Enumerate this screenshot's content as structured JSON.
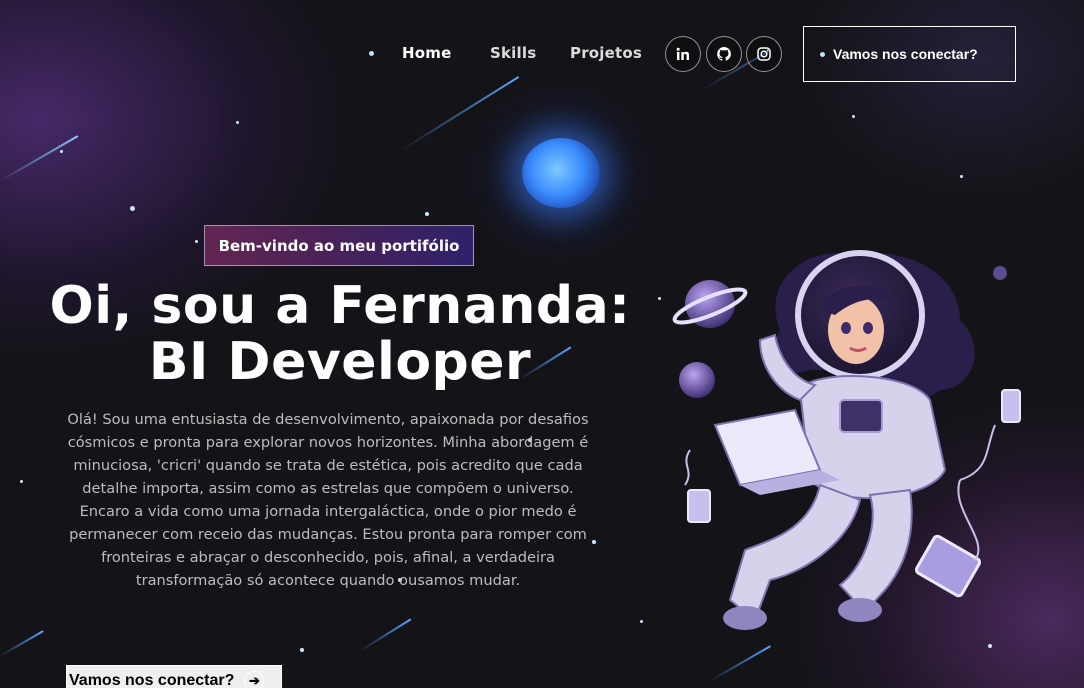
{
  "nav": {
    "links": [
      "Home",
      "Skills",
      "Projetos"
    ],
    "social": [
      "linkedin-icon",
      "github-icon",
      "instagram-icon"
    ],
    "connect_label": "Vamos nos conectar?"
  },
  "hero": {
    "tagline": "Bem-vindo ao meu portifólio",
    "title_line1": "Oi, sou a Fernanda:",
    "title_line2": "BI Developer",
    "description": "Olá! Sou uma entusiasta de desenvolvimento, apaixonada por desafios cósmicos e pronta para explorar novos horizontes. Minha abordagem é minuciosa, 'cricri' quando se trata de estética, pois acredito que cada detalhe importa, assim como as estrelas que compõem o universo. Encaro a vida como uma jornada intergaláctica, onde o pior medo é permanecer com receio das mudanças. Estou pronta para romper com fronteiras e abraçar o desconhecido, pois, afinal, a verdadeira transformação só acontece quando ousamos mudar.",
    "cta_label": "Vamos nos conectar?"
  },
  "colors": {
    "background": "#141317",
    "accent_blue": "#3a8cff",
    "accent_purple": "#7a5fd6"
  }
}
